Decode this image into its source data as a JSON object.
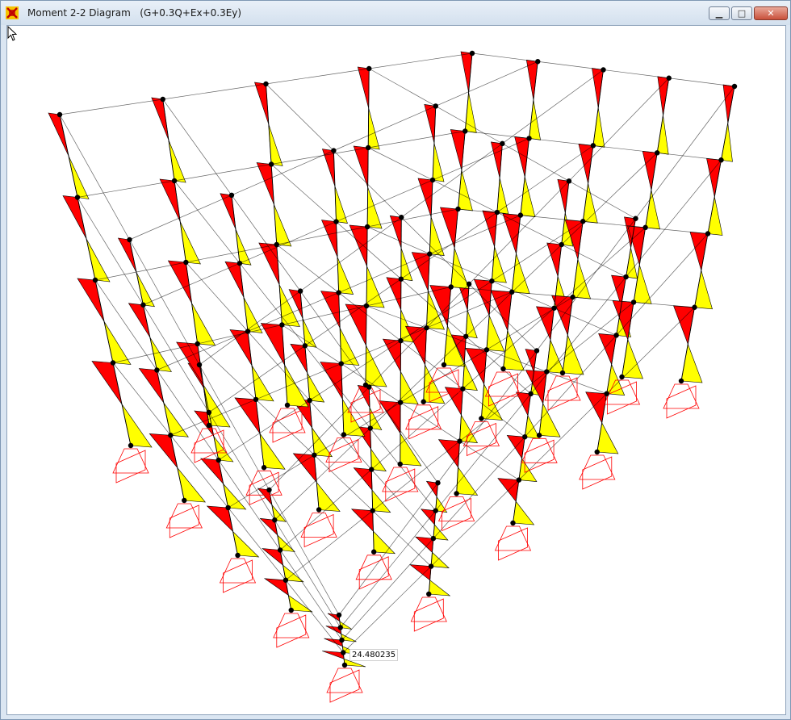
{
  "window": {
    "title": "Moment 2-2 Diagram   (G+0.3Q+Ex+0.3Ey)",
    "icon": "app-logo-icon",
    "controls": [
      "minimize-icon",
      "maximize-icon",
      "close-icon"
    ]
  },
  "diagram": {
    "tooltip_value": "24.480235",
    "colors": {
      "positive": "#ff0000",
      "negative": "#ffff00",
      "frame": "#000000",
      "support": "#ff0000"
    }
  }
}
